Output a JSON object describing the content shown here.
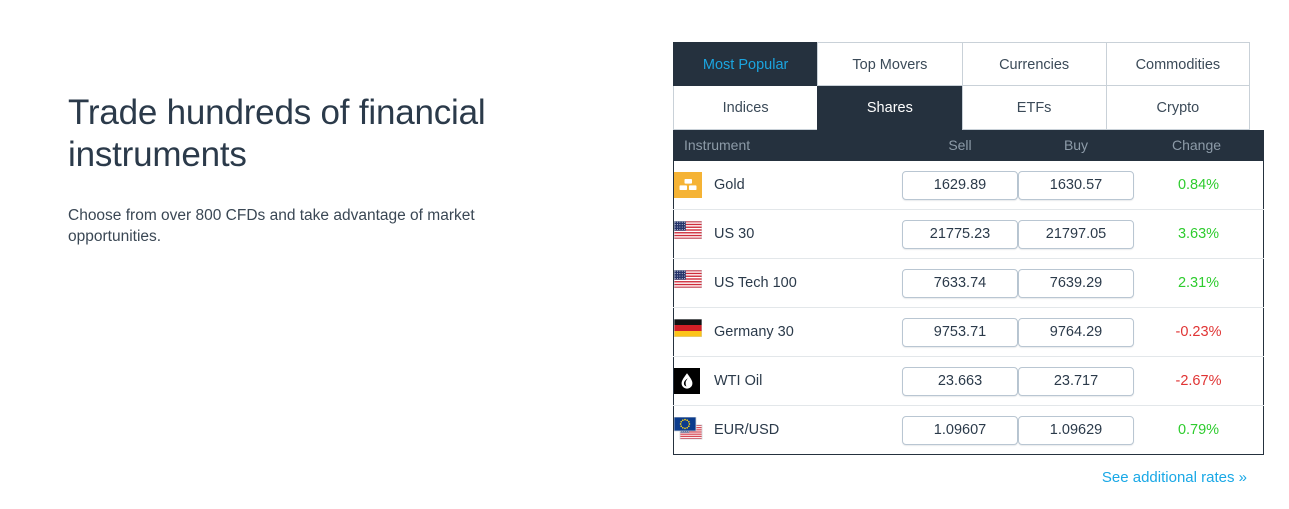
{
  "promo": {
    "title": "Trade hundreds of financial instruments",
    "subtitle": "Choose from over 800 CFDs and take advantage of market opportunities."
  },
  "widget": {
    "tabs_row1": [
      {
        "label": "Most Popular",
        "state": "active-accent"
      },
      {
        "label": "Top Movers",
        "state": "normal"
      },
      {
        "label": "Currencies",
        "state": "normal"
      },
      {
        "label": "Commodities",
        "state": "normal"
      }
    ],
    "tabs_row2": [
      {
        "label": "Indices",
        "state": "normal"
      },
      {
        "label": "Shares",
        "state": "active"
      },
      {
        "label": "ETFs",
        "state": "normal"
      },
      {
        "label": "Crypto",
        "state": "normal"
      }
    ],
    "columns": {
      "instrument": "Instrument",
      "sell": "Sell",
      "buy": "Buy",
      "change": "Change"
    },
    "rows": [
      {
        "icon": "gold-bars-icon",
        "name": "Gold",
        "sell": "1629.89",
        "buy": "1630.57",
        "change": "0.84%",
        "direction": "up"
      },
      {
        "icon": "flag-us-icon",
        "name": "US 30",
        "sell": "21775.23",
        "buy": "21797.05",
        "change": "3.63%",
        "direction": "up"
      },
      {
        "icon": "flag-us-icon",
        "name": "US Tech 100",
        "sell": "7633.74",
        "buy": "7639.29",
        "change": "2.31%",
        "direction": "up"
      },
      {
        "icon": "flag-germany-icon",
        "name": "Germany 30",
        "sell": "9753.71",
        "buy": "9764.29",
        "change": "-0.23%",
        "direction": "down"
      },
      {
        "icon": "oil-droplet-icon",
        "name": "WTI Oil",
        "sell": "23.663",
        "buy": "23.717",
        "change": "-2.67%",
        "direction": "down"
      },
      {
        "icon": "flag-eur-usd-icon",
        "name": "EUR/USD",
        "sell": "1.09607",
        "buy": "1.09629",
        "change": "0.79%",
        "direction": "up"
      }
    ],
    "see_more": "See additional rates »"
  },
  "colors": {
    "dark": "#25313e",
    "accent_blue": "#1ba5e0",
    "link_blue": "#19a8e6",
    "up_green": "#2ecc2e",
    "down_red": "#e03434",
    "gold": "#f5b335"
  }
}
